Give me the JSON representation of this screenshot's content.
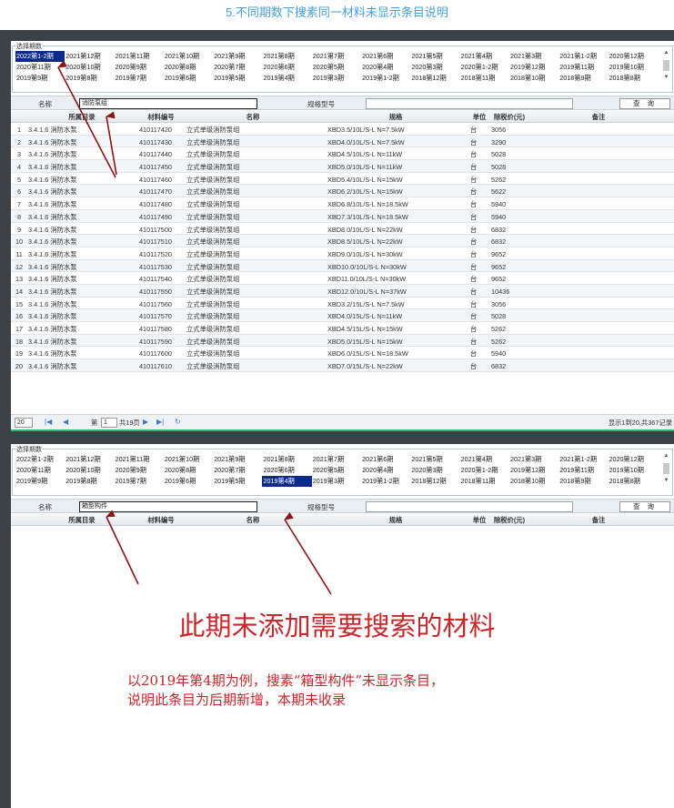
{
  "caption": "5.不同期数下搜素同一材料未显示条目说明",
  "periods": [
    [
      "2022第1-2期",
      "2021第12期",
      "2021第11期",
      "2021第10期",
      "2021第9期",
      "2021第8期",
      "2021第7期",
      "2021第6期",
      "2021第5期",
      "2021第4期",
      "2021第3期",
      "2021第1-2期",
      "2020第12期"
    ],
    [
      "2020第11期",
      "2020第10期",
      "2020第9期",
      "2020第8期",
      "2020第7期",
      "2020第6期",
      "2020第5期",
      "2020第4期",
      "2020第3期",
      "2020第1-2期",
      "2019第12期",
      "2019第11期",
      "2019第10期"
    ],
    [
      "2019第9期",
      "2019第8期",
      "2019第7期",
      "2019第6期",
      "2019第5期",
      "2019第4期",
      "2019第3期",
      "2019第1-2期",
      "2018第12期",
      "2018第11期",
      "2018第10期",
      "2018第9期",
      "2018第8期"
    ]
  ],
  "panel1": {
    "legend": "选择期数",
    "selected_period": "2022第1-2期",
    "name_label": "名称",
    "name_value": "消防泵组",
    "spec_label": "规格型号",
    "spec_value": "",
    "search_button": "查 询",
    "columns": [
      "所属目录",
      "材料编号",
      "名称",
      "规格",
      "单位",
      "除税价(元)",
      "备注"
    ],
    "rows": [
      [
        "1",
        "3.4.1.6 消防水泵",
        "410117420",
        "立式单级消防泵组",
        "XBD3.5/10L/S-L N=7.5kW",
        "台",
        "3056",
        ""
      ],
      [
        "2",
        "3.4.1.6 消防水泵",
        "410117430",
        "立式单级消防泵组",
        "XBD4.0/10L/S-L N=7.5kW",
        "台",
        "3290",
        ""
      ],
      [
        "3",
        "3.4.1.6 消防水泵",
        "410117440",
        "立式单级消防泵组",
        "XBD4.5/10L/S-L N=11kW",
        "台",
        "5028",
        ""
      ],
      [
        "4",
        "3.4.1.6 消防水泵",
        "410117450",
        "立式单级消防泵组",
        "XBD5.0/10L/S-L N=11kW",
        "台",
        "5028",
        ""
      ],
      [
        "5",
        "3.4.1.6 消防水泵",
        "410117460",
        "立式单级消防泵组",
        "XBD5.4/10L/S-L N=15kW",
        "台",
        "5262",
        ""
      ],
      [
        "6",
        "3.4.1.6 消防水泵",
        "410117470",
        "立式单级消防泵组",
        "XBD6.2/10L/S-L N=15kW",
        "台",
        "5622",
        ""
      ],
      [
        "7",
        "3.4.1.6 消防水泵",
        "410117480",
        "立式单级消防泵组",
        "XBD6.8/10L/S-L N=18.5kW",
        "台",
        "5940",
        ""
      ],
      [
        "8",
        "3.4.1.6 消防水泵",
        "410117490",
        "立式单级消防泵组",
        "XBD7.3/10L/S-L N=18.5kW",
        "台",
        "5940",
        ""
      ],
      [
        "9",
        "3.4.1.6 消防水泵",
        "410117500",
        "立式单级消防泵组",
        "XBD8.0/10L/S-L N=22kW",
        "台",
        "6832",
        ""
      ],
      [
        "10",
        "3.4.1.6 消防水泵",
        "410117510",
        "立式单级消防泵组",
        "XBD8.5/10L/S-L N=22kW",
        "台",
        "6832",
        ""
      ],
      [
        "11",
        "3.4.1.6 消防水泵",
        "410117520",
        "立式单级消防泵组",
        "XBD9.0/10L/S-L N=30kW",
        "台",
        "9652",
        ""
      ],
      [
        "12",
        "3.4.1.6 消防水泵",
        "410117530",
        "立式单级消防泵组",
        "XBD10.0/10L/S-L N=30kW",
        "台",
        "9652",
        ""
      ],
      [
        "13",
        "3.4.1.6 消防水泵",
        "410117540",
        "立式单级消防泵组",
        "XBD11.0/10L/S-L N=30kW",
        "台",
        "9652",
        ""
      ],
      [
        "14",
        "3.4.1.6 消防水泵",
        "410117550",
        "立式单级消防泵组",
        "XBD12.0/10L/S-L N=37kW",
        "台",
        "10436",
        ""
      ],
      [
        "15",
        "3.4.1.6 消防水泵",
        "410117560",
        "立式单级消防泵组",
        "XBD3.2/15L/S-L N=7.5kW",
        "台",
        "3056",
        ""
      ],
      [
        "16",
        "3.4.1.6 消防水泵",
        "410117570",
        "立式单级消防泵组",
        "XBD4.0/15L/S-L N=11kW",
        "台",
        "5028",
        ""
      ],
      [
        "17",
        "3.4.1.6 消防水泵",
        "410117580",
        "立式单级消防泵组",
        "XBD4.5/15L/S-L N=15kW",
        "台",
        "5262",
        ""
      ],
      [
        "18",
        "3.4.1.6 消防水泵",
        "410117590",
        "立式单级消防泵组",
        "XBD5.0/15L/S-L N=15kW",
        "台",
        "5262",
        ""
      ],
      [
        "19",
        "3.4.1.6 消防水泵",
        "410117600",
        "立式单级消防泵组",
        "XBD6.0/15L/S-L N=18.5kW",
        "台",
        "5940",
        ""
      ],
      [
        "20",
        "3.4.1.6 消防水泵",
        "410117610",
        "立式单级消防泵组",
        "XBD7.0/15L/S-L N=22kW",
        "台",
        "6832",
        ""
      ]
    ],
    "pager": {
      "page_size": "20",
      "page_prefix": "第",
      "page_value": "1",
      "page_total": "共19页",
      "summary": "显示1到20,共367记录"
    }
  },
  "panel2": {
    "legend": "选择期数",
    "selected_period": "2019第4期",
    "name_label": "名称",
    "name_value": "箱型构件",
    "spec_label": "规格型号",
    "spec_value": "",
    "search_button": "查 询",
    "columns": [
      "所属目录",
      "材料编号",
      "名称",
      "规格",
      "单位",
      "除税价(元)",
      "备注"
    ]
  },
  "annotation": {
    "headline": "此期未添加需要搜索的材料",
    "line1": "以2019年第4期为例，搜素“箱型构件”未显示条目，",
    "line2": "说明此条目为后期新增，本期未收录"
  },
  "colors": {
    "accent_caption": "#4aa0d8",
    "annotation_red": "#c8282c",
    "selected_period_bg": "#0b2a8c",
    "stage_bg": "#3a4247"
  }
}
